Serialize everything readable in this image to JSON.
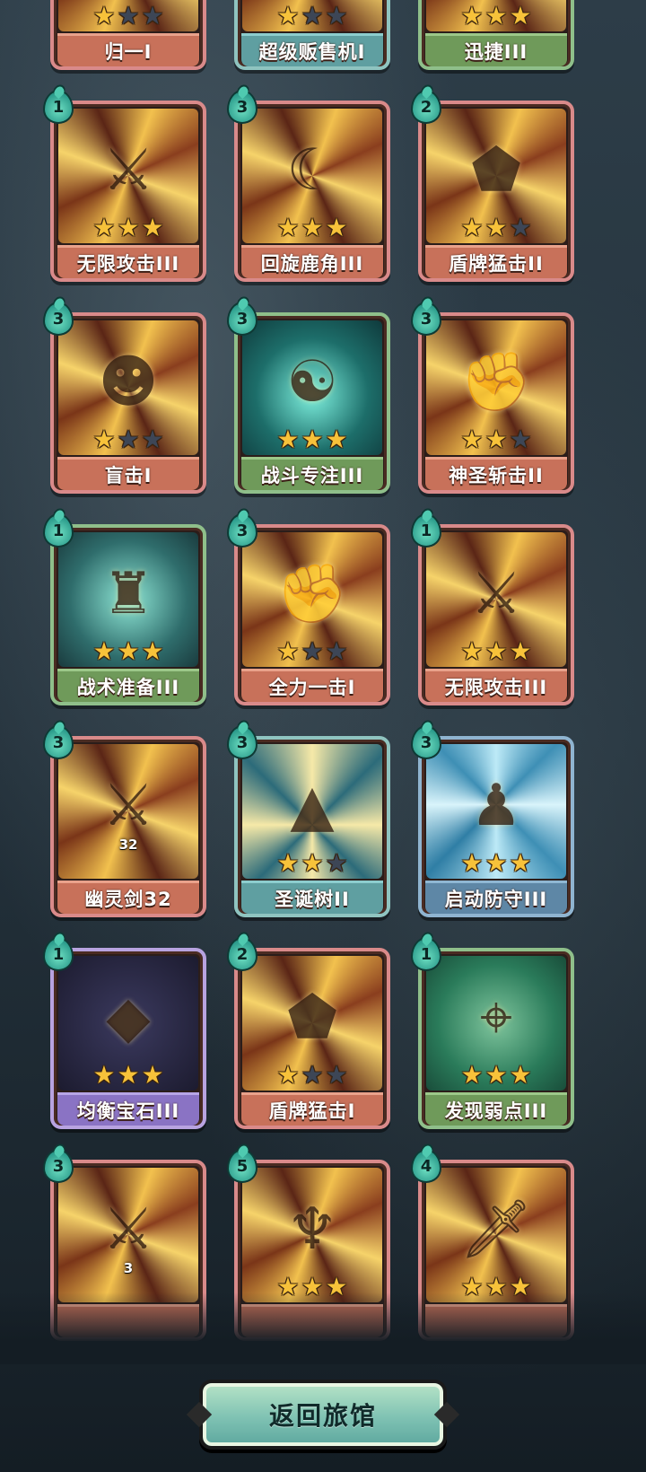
{
  "cards": [
    {
      "name": "归一I",
      "cost": null,
      "stars": 1,
      "theme": "c-red",
      "art": "warm",
      "icon": "scale-icon"
    },
    {
      "name": "超级贩售机I",
      "cost": null,
      "stars": 1,
      "theme": "c-teal",
      "art": "warm",
      "icon": "vending-machine-icon"
    },
    {
      "name": "迅捷III",
      "cost": null,
      "stars": 3,
      "theme": "c-green",
      "art": "warm",
      "icon": "swift-icon"
    },
    {
      "name": "无限攻击III",
      "cost": "1",
      "stars": 3,
      "theme": "c-red",
      "art": "warm",
      "icon": "crossed-swords-icon"
    },
    {
      "name": "回旋鹿角III",
      "cost": "3",
      "stars": 3,
      "theme": "c-red",
      "art": "warm",
      "icon": "antler-icon"
    },
    {
      "name": "盾牌猛击II",
      "cost": "2",
      "stars": 2,
      "theme": "c-red",
      "art": "warm",
      "icon": "shield-icon"
    },
    {
      "name": "盲击I",
      "cost": "3",
      "stars": 1,
      "theme": "c-red",
      "art": "warm",
      "icon": "blind-warrior-icon"
    },
    {
      "name": "战斗专注III",
      "cost": "3",
      "stars": 3,
      "theme": "c-green",
      "art": "teal-art",
      "icon": "meditation-icon"
    },
    {
      "name": "神圣斩击II",
      "cost": "3",
      "stars": 2,
      "theme": "c-red",
      "art": "warm",
      "icon": "holy-staff-icon"
    },
    {
      "name": "战术准备III",
      "cost": "1",
      "stars": 3,
      "theme": "c-green",
      "art": "ghost-art",
      "icon": "armor-icon"
    },
    {
      "name": "全力一击I",
      "cost": "3",
      "stars": 1,
      "theme": "c-red",
      "art": "warm",
      "icon": "fist-icon"
    },
    {
      "name": "无限攻击III",
      "cost": "1",
      "stars": 3,
      "theme": "c-red",
      "art": "warm",
      "icon": "crossed-swords-icon"
    },
    {
      "name": "幽灵剑32",
      "cost": "3",
      "stars": 0,
      "theme": "c-red",
      "art": "warm",
      "icon": "ghost-sword-icon",
      "sword_num": "32"
    },
    {
      "name": "圣诞树II",
      "cost": "3",
      "stars": 2,
      "theme": "c-teal",
      "art": "tree-art",
      "icon": "christmas-tree-icon"
    },
    {
      "name": "启动防守III",
      "cost": "3",
      "stars": 3,
      "theme": "c-blue",
      "art": "blue-art",
      "icon": "silhouette-icon"
    },
    {
      "name": "均衡宝石III",
      "cost": "1",
      "stars": 3,
      "theme": "c-purple",
      "art": "gem-art",
      "icon": "gem-icon"
    },
    {
      "name": "盾牌猛击I",
      "cost": "2",
      "stars": 1,
      "theme": "c-red",
      "art": "warm",
      "icon": "shield-icon"
    },
    {
      "name": "发现弱点III",
      "cost": "1",
      "stars": 3,
      "theme": "c-green",
      "art": "green-art",
      "icon": "robot-target-icon"
    },
    {
      "name": "",
      "cost": "3",
      "stars": 0,
      "theme": "c-red",
      "art": "warm",
      "icon": "ghost-sword-icon",
      "sword_num": "3"
    },
    {
      "name": "",
      "cost": "5",
      "stars": 3,
      "theme": "c-red",
      "art": "warm",
      "icon": "creature-icon"
    },
    {
      "name": "",
      "cost": "4",
      "stars": 3,
      "theme": "c-red",
      "art": "warm",
      "icon": "dagger-icon"
    }
  ],
  "back_button": {
    "label": "返回旅馆"
  }
}
